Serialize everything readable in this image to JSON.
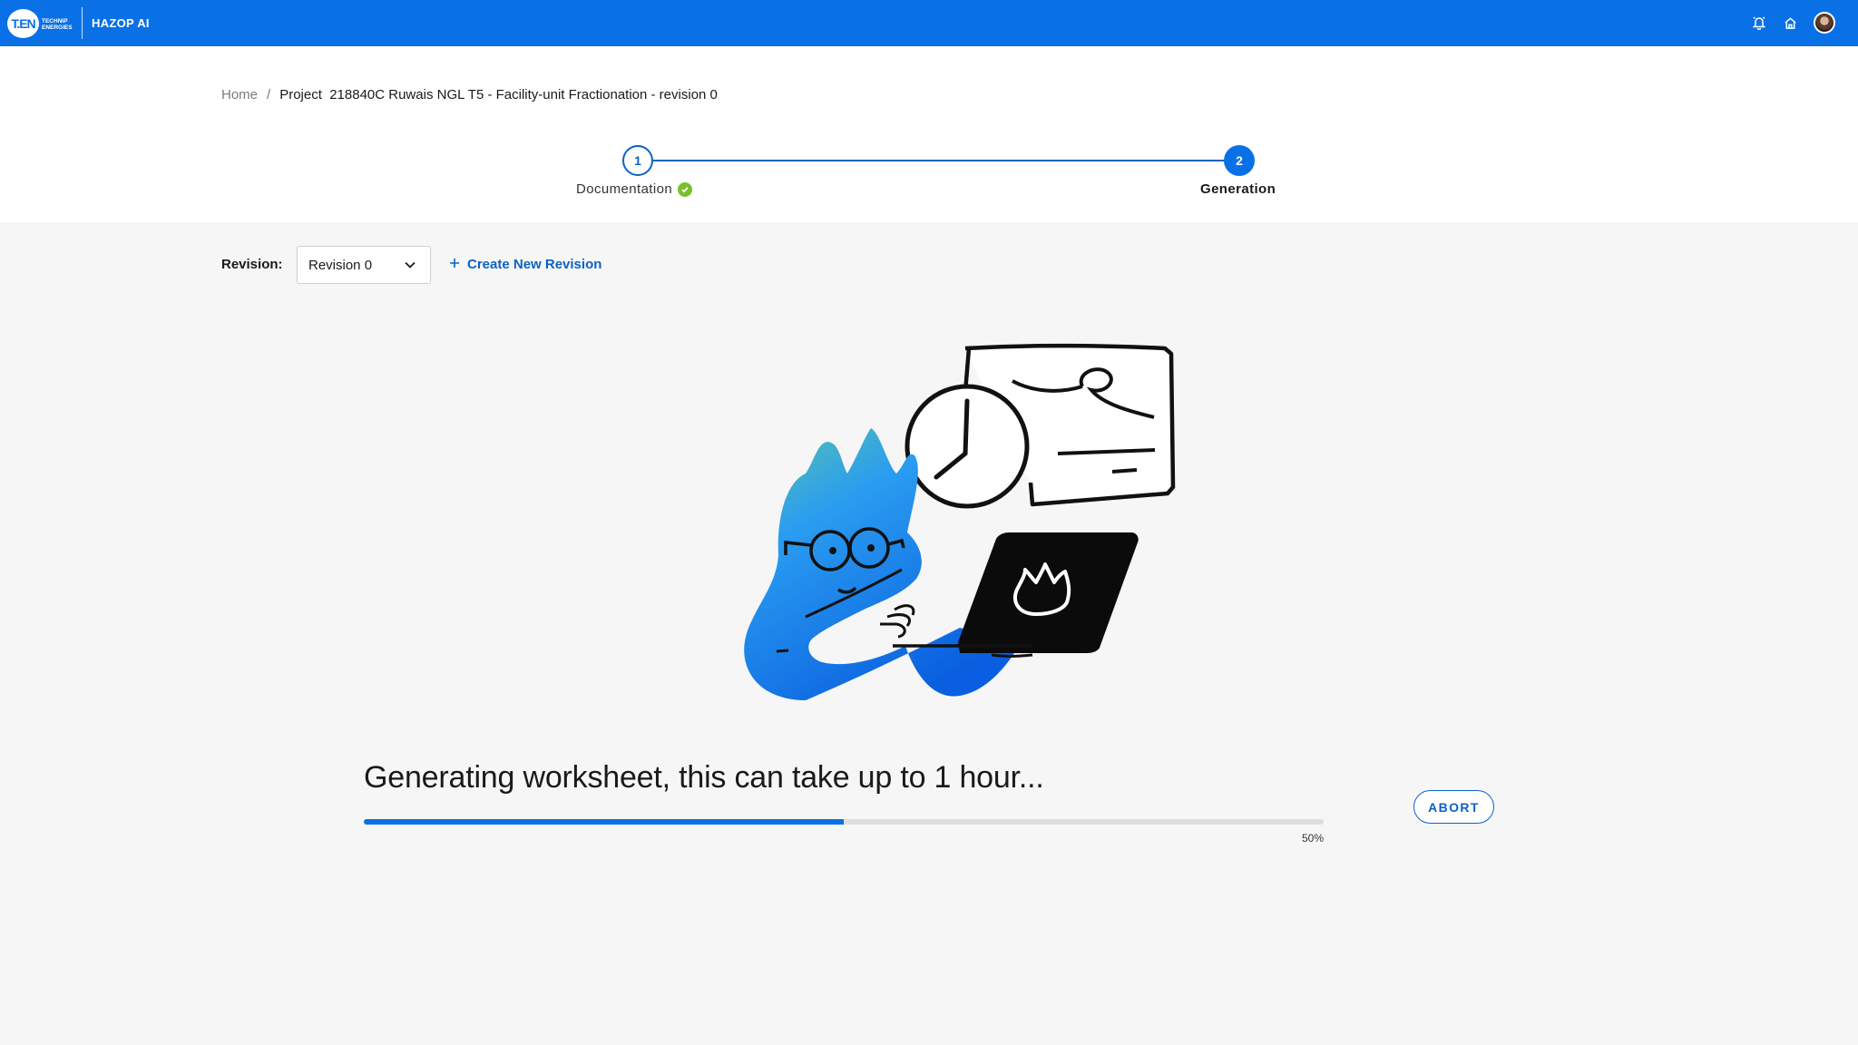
{
  "brand": {
    "logo_text": "T.EN",
    "logo_subtext": "TECHNIP ENERGIES",
    "app_title": "HAZOP AI",
    "accent_color": "#0a70e6"
  },
  "topbar": {
    "icons": [
      "bell-icon",
      "home-icon",
      "user-avatar"
    ]
  },
  "breadcrumb": {
    "home": "Home",
    "separator": "/",
    "current": "Project  218840C Ruwais NGL T5 - Facility-unit Fractionation - revision 0"
  },
  "stepper": {
    "steps": [
      {
        "number": "1",
        "label": "Documentation",
        "status": "completed"
      },
      {
        "number": "2",
        "label": "Generation",
        "status": "active"
      }
    ]
  },
  "revision": {
    "label": "Revision:",
    "selected": "Revision 0",
    "create_new": "Create New Revision"
  },
  "progress": {
    "message": "Generating worksheet, this can take up to 1 hour...",
    "percent_value": 0.5,
    "percent_label": "50%",
    "abort_label": "ABORT"
  }
}
